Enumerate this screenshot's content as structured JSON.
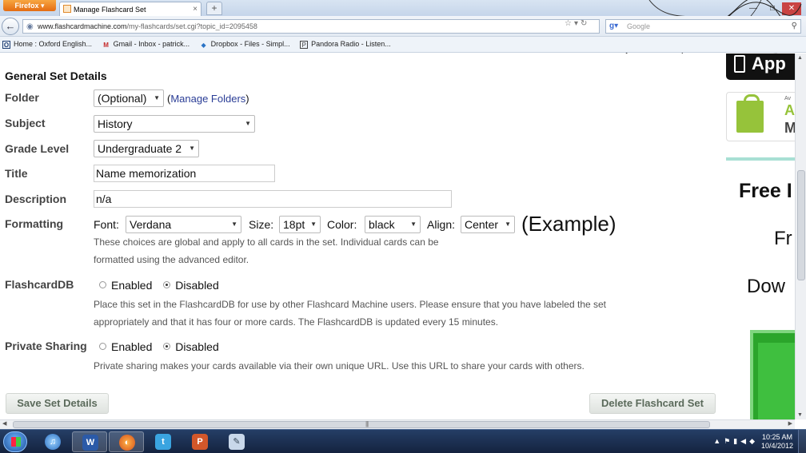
{
  "browser": {
    "firefox_label": "Firefox ▾",
    "tab_title": "Manage Flashcard Set",
    "tab_close": "×",
    "new_tab": "+",
    "url_host": "www.flashcardmachine.com",
    "url_path": "/my-flashcards/set.cgi?topic_id=2095458",
    "search_placeholder": "Google",
    "bookmarks": [
      {
        "label": "Home : Oxford English...",
        "icon": "oxford-icon"
      },
      {
        "label": "Gmail - Inbox - patrick...",
        "icon": "gmail-icon"
      },
      {
        "label": "Dropbox - Files - Simpl...",
        "icon": "dropbox-icon"
      },
      {
        "label": "Pandora Radio - Listen...",
        "icon": "pandora-icon"
      }
    ]
  },
  "form": {
    "section_title": "General Set Details",
    "folder": {
      "label": "Folder",
      "value": "(Optional)",
      "link_open": "(",
      "link": "Manage Folders",
      "link_close": ")"
    },
    "subject": {
      "label": "Subject",
      "value": "History"
    },
    "grade": {
      "label": "Grade Level",
      "value": "Undergraduate 2"
    },
    "title": {
      "label": "Title",
      "value": "Name memorization"
    },
    "description": {
      "label": "Description",
      "value": "n/a"
    },
    "formatting": {
      "label": "Formatting",
      "font_label": "Font:",
      "font_value": "Verdana",
      "size_label": "Size:",
      "size_value": "18pt",
      "color_label": "Color:",
      "color_value": "black",
      "align_label": "Align:",
      "align_value": "Center",
      "example": "(Example)",
      "help_line1": "These choices are global and apply to all cards in the set. Individual cards can be",
      "help_line2": "formatted using the advanced editor."
    },
    "flashcarddb": {
      "label": "FlashcardDB",
      "enabled": "Enabled",
      "disabled": "Disabled",
      "selected": "Disabled",
      "help_line1": "Place this set in the FlashcardDB for use by other Flashcard Machine users. Please ensure that you have labeled the set",
      "help_line2": "appropriately and that it has four or more cards. The FlashcardDB is updated every 15 minutes."
    },
    "private_sharing": {
      "label": "Private Sharing",
      "enabled": "Enabled",
      "disabled": "Disabled",
      "selected": "Disabled",
      "help": "Private sharing makes your cards available via their own unique URL. Use this URL to share your cards with others."
    },
    "save_button": "Save Set Details",
    "delete_button": "Delete Flashcard Set"
  },
  "ads": {
    "app_badge": "App",
    "android_small": "Av",
    "android_big": "A",
    "android_m": "M",
    "free_text": "Free I",
    "fr_text": "Fr",
    "down_text": "Dow"
  },
  "taskbar": {
    "clock_time": "10:25 AM",
    "clock_date": "10/4/2012"
  },
  "colors": {
    "link": "#2a3d96",
    "android_green": "#96c33a",
    "ad_green": "#2ba52b",
    "taskbar": "#14233f"
  }
}
